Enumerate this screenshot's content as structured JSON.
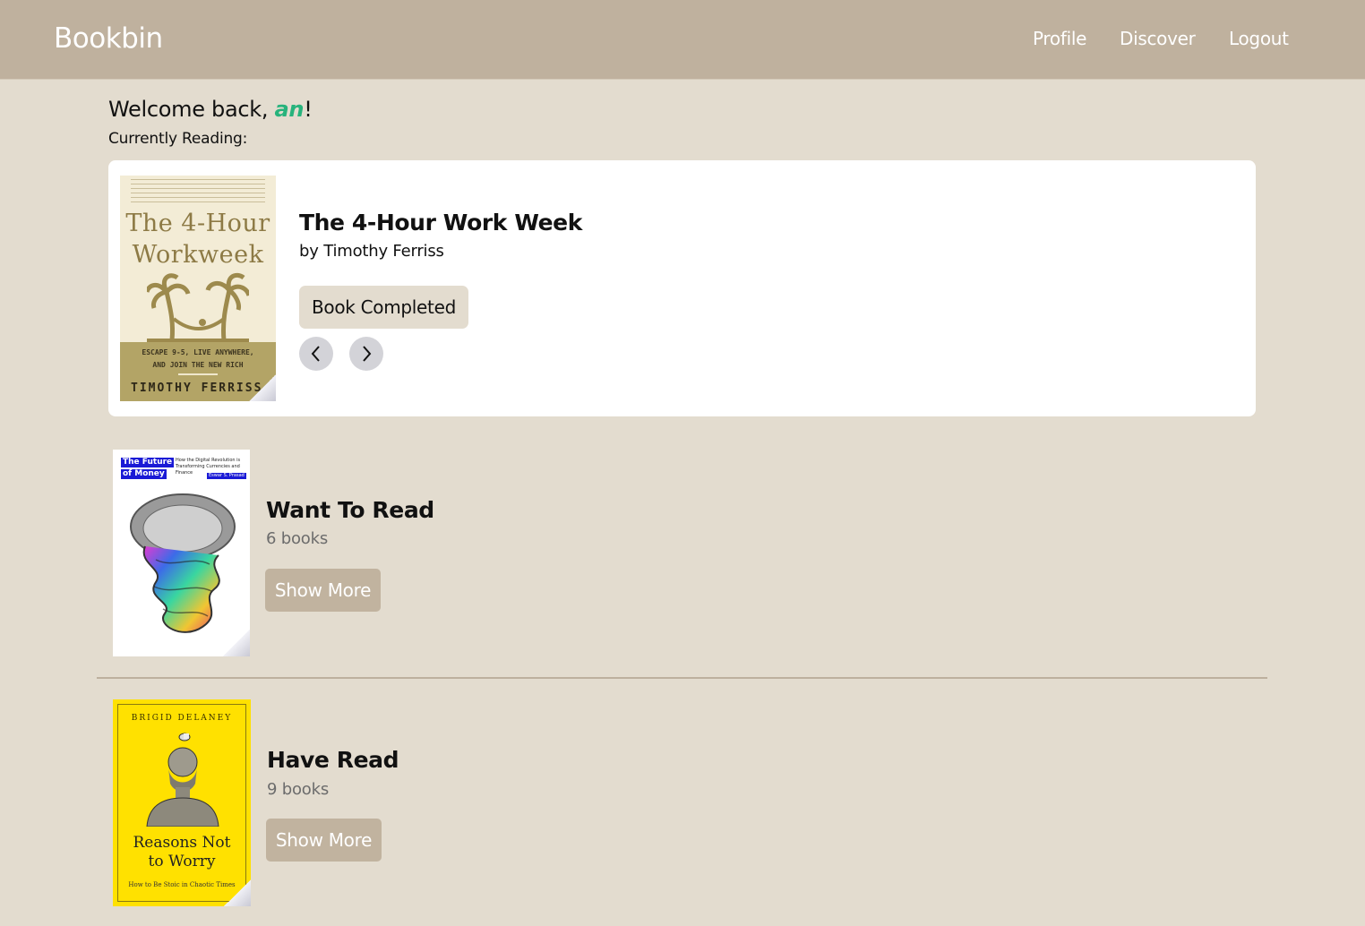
{
  "nav": {
    "brand": "Bookbin",
    "links": [
      "Profile",
      "Discover",
      "Logout"
    ]
  },
  "welcome": {
    "prefix": "Welcome back, ",
    "username": "an",
    "suffix": "!"
  },
  "currently_reading": {
    "label": "Currently Reading:",
    "book": {
      "title": "The 4-Hour Work Week",
      "author": "by Timothy Ferriss",
      "cover_text": {
        "title_line1": "The 4-Hour",
        "title_line2": "Workweek",
        "tagline_line1": "ESCAPE 9-5, LIVE ANYWHERE,",
        "tagline_line2": "AND JOIN THE NEW RICH",
        "author": "TIMOTHY FERRISS"
      }
    },
    "complete_button": "Book Completed",
    "prev_icon": "chevron-left-icon",
    "next_icon": "chevron-right-icon"
  },
  "shelves": [
    {
      "title": "Want To Read",
      "count": "6 books",
      "button": "Show More",
      "cover_text": {
        "title_line1": "The Future",
        "title_line2": "of Money",
        "sub": "How the Digital Revolution is Transforming Currencies and Finance",
        "author": "Eswar S. Prasad"
      }
    },
    {
      "title": "Have Read",
      "count": "9 books",
      "button": "Show More",
      "cover_text": {
        "author": "BRIGID DELANEY",
        "title_line1": "Reasons Not",
        "title_line2": "to Worry",
        "sub": "How to Be Stoic in Chaotic Times"
      }
    }
  ],
  "colors": {
    "navbar": "#bfb19e",
    "background": "#e3dccf",
    "accent": "#27b37c",
    "button": "#c1b39f"
  }
}
